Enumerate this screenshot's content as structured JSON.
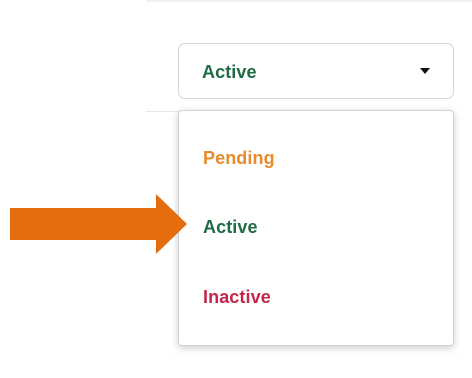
{
  "select": {
    "value": "Active",
    "value_color": "#1f6b43"
  },
  "dropdown": {
    "options": [
      {
        "label": "Pending",
        "color": "#e88b2d"
      },
      {
        "label": "Active",
        "color": "#1f6b43"
      },
      {
        "label": "Inactive",
        "color": "#c3264a"
      }
    ]
  },
  "annotation": {
    "arrow_color": "#e46d10",
    "points_to": "Active"
  }
}
